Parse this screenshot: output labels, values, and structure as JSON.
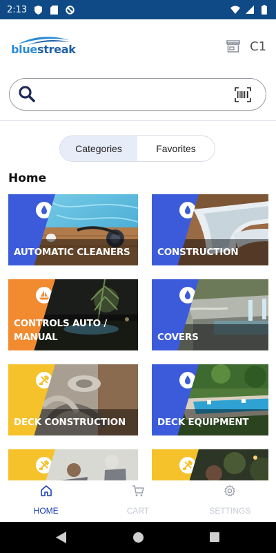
{
  "status_bar": {
    "time": "2:13",
    "icons": [
      "shield-icon",
      "sd-card-icon",
      "data-saver-icon",
      "wifi-icon",
      "signal-icon",
      "battery-icon"
    ]
  },
  "header": {
    "logo_text_blue": "blue",
    "logo_text_streak": "streak",
    "store_icon": "store-icon",
    "store_code": "C1"
  },
  "search": {
    "placeholder": "",
    "value": "",
    "icons": [
      "search-icon",
      "barcode-icon"
    ]
  },
  "tabs": [
    {
      "label": "Categories",
      "active": true
    },
    {
      "label": "Favorites",
      "active": false
    }
  ],
  "section_title": "Home",
  "categories": [
    {
      "label": "AUTOMATIC CLEANERS",
      "badge_color": "#3b5bdb",
      "icon": "water-drop-icon"
    },
    {
      "label": "CONSTRUCTION",
      "badge_color": "#3b5bdb",
      "icon": "water-drop-icon"
    },
    {
      "label": "CONTROLS AUTO / MANUAL",
      "badge_color": "#f28a30",
      "icon": "boat-icon"
    },
    {
      "label": "COVERS",
      "badge_color": "#3b5bdb",
      "icon": "water-drop-icon"
    },
    {
      "label": "DECK CONSTRUCTION",
      "badge_color": "#f5c22b",
      "icon": "tools-icon"
    },
    {
      "label": "DECK EQUIPMENT",
      "badge_color": "#3b5bdb",
      "icon": "water-drop-icon"
    },
    {
      "label": "",
      "badge_color": "#f5c22b",
      "icon": "tools-icon"
    },
    {
      "label": "",
      "badge_color": "#f5c22b",
      "icon": "tools-icon"
    }
  ],
  "bottom_nav": [
    {
      "label": "HOME",
      "icon": "home-icon",
      "active": true
    },
    {
      "label": "CART",
      "icon": "cart-icon",
      "active": false
    },
    {
      "label": "SETTINGS",
      "icon": "gear-icon",
      "active": false
    }
  ],
  "colors": {
    "status_bar": "#0f4a86",
    "accent": "#1a3fb8",
    "tab_active_bg": "#e6ecf8",
    "nav_inactive": "#c8ccd6"
  }
}
